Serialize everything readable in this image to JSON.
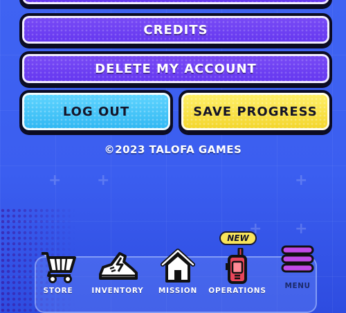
{
  "settings_menu": {
    "credits_label": "CREDITS",
    "delete_account_label": "DELETE MY ACCOUNT",
    "logout_label": "LOG OUT",
    "save_progress_label": "SAVE PROGRESS",
    "copyright": "©2023 TALOFA GAMES"
  },
  "bottom_nav": {
    "items": [
      {
        "label": "STORE",
        "icon": "cart-icon"
      },
      {
        "label": "INVENTORY",
        "icon": "sneaker-icon"
      },
      {
        "label": "MISSION",
        "icon": "home-icon"
      },
      {
        "label": "OPERATIONS",
        "icon": "walkie-talkie-icon"
      }
    ],
    "new_badge": "NEW",
    "menu_label": "MENU",
    "menu_icon": "hamburger-menu-icon"
  },
  "colors": {
    "background": "#3f63f2",
    "purple_button": "#6a3cf0",
    "cyan_button": "#4cc8fa",
    "yellow_button": "#f6dc3a",
    "menu_icon": "#c14ae8",
    "walkie_talkie": "#e8455a"
  }
}
